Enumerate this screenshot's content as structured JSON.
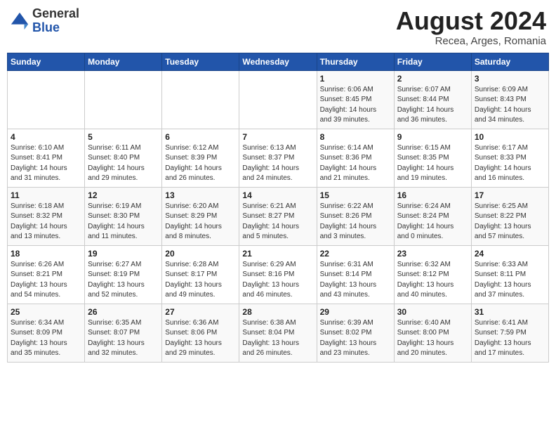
{
  "header": {
    "logo_general": "General",
    "logo_blue": "Blue",
    "title": "August 2024",
    "location": "Recea, Arges, Romania"
  },
  "weekdays": [
    "Sunday",
    "Monday",
    "Tuesday",
    "Wednesday",
    "Thursday",
    "Friday",
    "Saturday"
  ],
  "weeks": [
    [
      {
        "day": "",
        "detail": ""
      },
      {
        "day": "",
        "detail": ""
      },
      {
        "day": "",
        "detail": ""
      },
      {
        "day": "",
        "detail": ""
      },
      {
        "day": "1",
        "detail": "Sunrise: 6:06 AM\nSunset: 8:45 PM\nDaylight: 14 hours\nand 39 minutes."
      },
      {
        "day": "2",
        "detail": "Sunrise: 6:07 AM\nSunset: 8:44 PM\nDaylight: 14 hours\nand 36 minutes."
      },
      {
        "day": "3",
        "detail": "Sunrise: 6:09 AM\nSunset: 8:43 PM\nDaylight: 14 hours\nand 34 minutes."
      }
    ],
    [
      {
        "day": "4",
        "detail": "Sunrise: 6:10 AM\nSunset: 8:41 PM\nDaylight: 14 hours\nand 31 minutes."
      },
      {
        "day": "5",
        "detail": "Sunrise: 6:11 AM\nSunset: 8:40 PM\nDaylight: 14 hours\nand 29 minutes."
      },
      {
        "day": "6",
        "detail": "Sunrise: 6:12 AM\nSunset: 8:39 PM\nDaylight: 14 hours\nand 26 minutes."
      },
      {
        "day": "7",
        "detail": "Sunrise: 6:13 AM\nSunset: 8:37 PM\nDaylight: 14 hours\nand 24 minutes."
      },
      {
        "day": "8",
        "detail": "Sunrise: 6:14 AM\nSunset: 8:36 PM\nDaylight: 14 hours\nand 21 minutes."
      },
      {
        "day": "9",
        "detail": "Sunrise: 6:15 AM\nSunset: 8:35 PM\nDaylight: 14 hours\nand 19 minutes."
      },
      {
        "day": "10",
        "detail": "Sunrise: 6:17 AM\nSunset: 8:33 PM\nDaylight: 14 hours\nand 16 minutes."
      }
    ],
    [
      {
        "day": "11",
        "detail": "Sunrise: 6:18 AM\nSunset: 8:32 PM\nDaylight: 14 hours\nand 13 minutes."
      },
      {
        "day": "12",
        "detail": "Sunrise: 6:19 AM\nSunset: 8:30 PM\nDaylight: 14 hours\nand 11 minutes."
      },
      {
        "day": "13",
        "detail": "Sunrise: 6:20 AM\nSunset: 8:29 PM\nDaylight: 14 hours\nand 8 minutes."
      },
      {
        "day": "14",
        "detail": "Sunrise: 6:21 AM\nSunset: 8:27 PM\nDaylight: 14 hours\nand 5 minutes."
      },
      {
        "day": "15",
        "detail": "Sunrise: 6:22 AM\nSunset: 8:26 PM\nDaylight: 14 hours\nand 3 minutes."
      },
      {
        "day": "16",
        "detail": "Sunrise: 6:24 AM\nSunset: 8:24 PM\nDaylight: 14 hours\nand 0 minutes."
      },
      {
        "day": "17",
        "detail": "Sunrise: 6:25 AM\nSunset: 8:22 PM\nDaylight: 13 hours\nand 57 minutes."
      }
    ],
    [
      {
        "day": "18",
        "detail": "Sunrise: 6:26 AM\nSunset: 8:21 PM\nDaylight: 13 hours\nand 54 minutes."
      },
      {
        "day": "19",
        "detail": "Sunrise: 6:27 AM\nSunset: 8:19 PM\nDaylight: 13 hours\nand 52 minutes."
      },
      {
        "day": "20",
        "detail": "Sunrise: 6:28 AM\nSunset: 8:17 PM\nDaylight: 13 hours\nand 49 minutes."
      },
      {
        "day": "21",
        "detail": "Sunrise: 6:29 AM\nSunset: 8:16 PM\nDaylight: 13 hours\nand 46 minutes."
      },
      {
        "day": "22",
        "detail": "Sunrise: 6:31 AM\nSunset: 8:14 PM\nDaylight: 13 hours\nand 43 minutes."
      },
      {
        "day": "23",
        "detail": "Sunrise: 6:32 AM\nSunset: 8:12 PM\nDaylight: 13 hours\nand 40 minutes."
      },
      {
        "day": "24",
        "detail": "Sunrise: 6:33 AM\nSunset: 8:11 PM\nDaylight: 13 hours\nand 37 minutes."
      }
    ],
    [
      {
        "day": "25",
        "detail": "Sunrise: 6:34 AM\nSunset: 8:09 PM\nDaylight: 13 hours\nand 35 minutes."
      },
      {
        "day": "26",
        "detail": "Sunrise: 6:35 AM\nSunset: 8:07 PM\nDaylight: 13 hours\nand 32 minutes."
      },
      {
        "day": "27",
        "detail": "Sunrise: 6:36 AM\nSunset: 8:06 PM\nDaylight: 13 hours\nand 29 minutes."
      },
      {
        "day": "28",
        "detail": "Sunrise: 6:38 AM\nSunset: 8:04 PM\nDaylight: 13 hours\nand 26 minutes."
      },
      {
        "day": "29",
        "detail": "Sunrise: 6:39 AM\nSunset: 8:02 PM\nDaylight: 13 hours\nand 23 minutes."
      },
      {
        "day": "30",
        "detail": "Sunrise: 6:40 AM\nSunset: 8:00 PM\nDaylight: 13 hours\nand 20 minutes."
      },
      {
        "day": "31",
        "detail": "Sunrise: 6:41 AM\nSunset: 7:59 PM\nDaylight: 13 hours\nand 17 minutes."
      }
    ]
  ]
}
